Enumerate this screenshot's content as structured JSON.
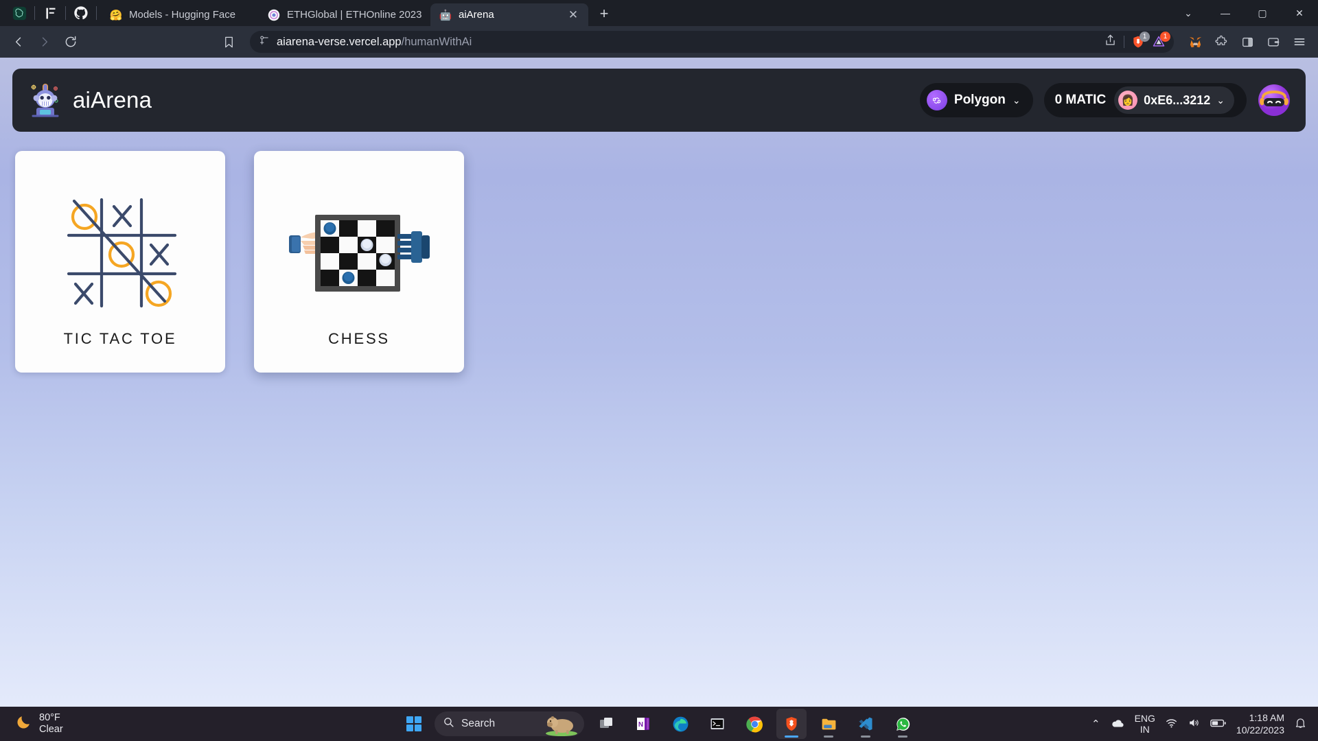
{
  "browser": {
    "pinned_tabs": [
      {
        "name": "chatgpt-pinned-tab",
        "glyph": "◎",
        "color": "#10a37f"
      },
      {
        "name": "huggingface-docs-pinned-tab",
        "glyph": "⫼",
        "color": "#e8e8ea"
      },
      {
        "name": "github-pinned-tab",
        "glyph": "",
        "color": "#f0f0f2"
      }
    ],
    "tabs": [
      {
        "title": "Models - Hugging Face",
        "favicon": "huggingface-icon",
        "glyph": "🤗",
        "active": false,
        "closable": false
      },
      {
        "title": "ETHGlobal | ETHOnline 2023",
        "favicon": "ethglobal-icon",
        "glyph": "◉",
        "active": false,
        "closable": false
      },
      {
        "title": "aiArena",
        "favicon": "aiarena-icon",
        "glyph": "🤖",
        "active": true,
        "closable": true
      }
    ],
    "new_tab_label": "+",
    "window_controls": {
      "minimize": "—",
      "maximize": "▢",
      "close": "✕",
      "tab_search": "⌄"
    },
    "nav": {
      "back": "‹",
      "forward": "›",
      "reload": "⟳",
      "bookmark": "bookmark-icon"
    },
    "address": {
      "domain": "aiarena-verse.vercel.app",
      "path": "/humanWithAi",
      "site_info_icon": "site-settings-icon"
    },
    "toolbar_right": {
      "share_icon": "share-icon",
      "shields_badge": "1",
      "shields_badge_color": "#8b8f99",
      "rewards_badge": "1",
      "rewards_badge_color": "#fb542b",
      "metamask_icon": "metamask-fox-icon",
      "extensions_icon": "extensions-puzzle-icon",
      "sidebar_icon": "sidebar-panel-icon",
      "wallet_icon": "brave-wallet-icon",
      "menu_icon": "hamburger-menu-icon"
    }
  },
  "app": {
    "brand": "aiArena",
    "network": {
      "label": "Polygon",
      "chevron": "⌄",
      "icon": "polygon-logo-icon",
      "color": "#8247e5"
    },
    "balance": "0 MATIC",
    "wallet_address": "0xE6...3212",
    "wallet_chevron": "⌄",
    "avatar": "user-avatar-robot",
    "cards": [
      {
        "label": "TIC TAC TOE",
        "art": "tic-tac-toe-illustration"
      },
      {
        "label": "CHESS",
        "art": "chess-robot-hand-illustration"
      }
    ]
  },
  "tic_tac_toe_board": {
    "cells": [
      [
        "O",
        "X",
        ""
      ],
      [
        "",
        "O",
        "X"
      ],
      [
        "X",
        "",
        "O"
      ]
    ],
    "win_line": "diagonal-top-left-to-bottom-right",
    "x_color": "#3b4a6b",
    "o_color": "#f5a623",
    "grid_color": "#3b4a6b"
  },
  "taskbar": {
    "weather": {
      "temperature": "80°F",
      "condition": "Clear",
      "icon": "moon-icon"
    },
    "start_label": "start-button",
    "search": {
      "placeholder": "Search",
      "icon": "search-icon",
      "decoration": "capybara-image"
    },
    "apps": [
      {
        "name": "task-view",
        "icon": "task-view-icon",
        "running": false,
        "active": false
      },
      {
        "name": "onenote",
        "icon": "onenote-icon",
        "running": false,
        "active": false
      },
      {
        "name": "microsoft-edge",
        "icon": "edge-icon",
        "running": false,
        "active": false
      },
      {
        "name": "terminal",
        "icon": "terminal-icon",
        "running": false,
        "active": false
      },
      {
        "name": "google-chrome",
        "icon": "chrome-icon",
        "running": false,
        "active": false
      },
      {
        "name": "brave-browser",
        "icon": "brave-icon",
        "running": true,
        "active": true
      },
      {
        "name": "file-explorer",
        "icon": "folder-icon",
        "running": true,
        "active": false
      },
      {
        "name": "visual-studio-code",
        "icon": "vscode-icon",
        "running": true,
        "active": false
      },
      {
        "name": "whatsapp",
        "icon": "whatsapp-icon",
        "running": true,
        "active": false
      }
    ],
    "tray": {
      "overflow": "⌃",
      "onedrive": "onedrive-icon",
      "language_line1": "ENG",
      "language_line2": "IN",
      "wifi": "wifi-icon",
      "volume": "volume-icon",
      "battery": "battery-icon",
      "time": "1:18 AM",
      "date": "10/22/2023",
      "notifications": "bell-icon"
    }
  }
}
